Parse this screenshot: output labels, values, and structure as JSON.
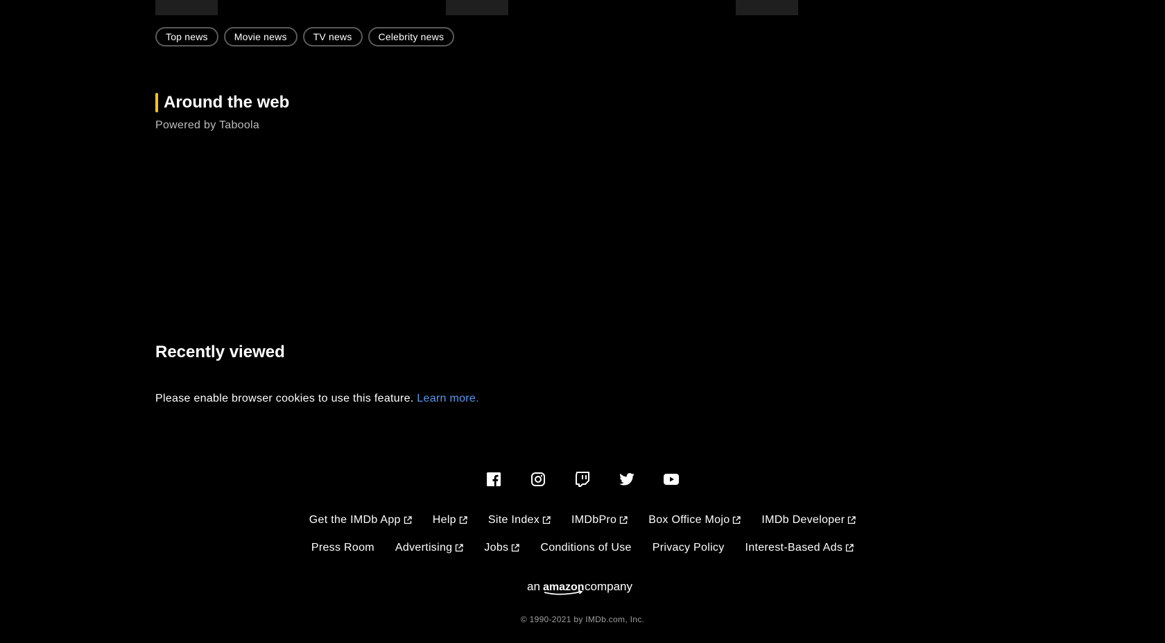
{
  "news_chips": [
    "Top news",
    "Movie news",
    "TV news",
    "Celebrity news"
  ],
  "around_web": {
    "title": "Around the web",
    "subtitle": "Powered by Taboola"
  },
  "recently_viewed": {
    "title": "Recently viewed",
    "message": "Please enable browser cookies to use this feature.",
    "link": "Learn more."
  },
  "social_icons": [
    "facebook-icon",
    "instagram-icon",
    "twitch-icon",
    "twitter-icon",
    "youtube-icon"
  ],
  "footer": {
    "row1": [
      {
        "label": "Get the IMDb App",
        "external": true
      },
      {
        "label": "Help",
        "external": true
      },
      {
        "label": "Site Index",
        "external": true
      },
      {
        "label": "IMDbPro",
        "external": true
      },
      {
        "label": "Box Office Mojo",
        "external": true
      },
      {
        "label": "IMDb Developer",
        "external": true
      }
    ],
    "row2": [
      {
        "label": "Press Room",
        "external": false
      },
      {
        "label": "Advertising",
        "external": true
      },
      {
        "label": "Jobs",
        "external": true
      },
      {
        "label": "Conditions of Use",
        "external": false
      },
      {
        "label": "Privacy Policy",
        "external": false
      },
      {
        "label": "Interest-Based Ads",
        "external": true
      }
    ],
    "amazon_prefix": "an",
    "amazon_brand": "amazon",
    "amazon_suffix": "company",
    "copyright": "© 1990-2021 by IMDb.com, Inc."
  },
  "colors": {
    "accent": "#f5c518",
    "link": "#5799ef",
    "background": "#000000"
  }
}
